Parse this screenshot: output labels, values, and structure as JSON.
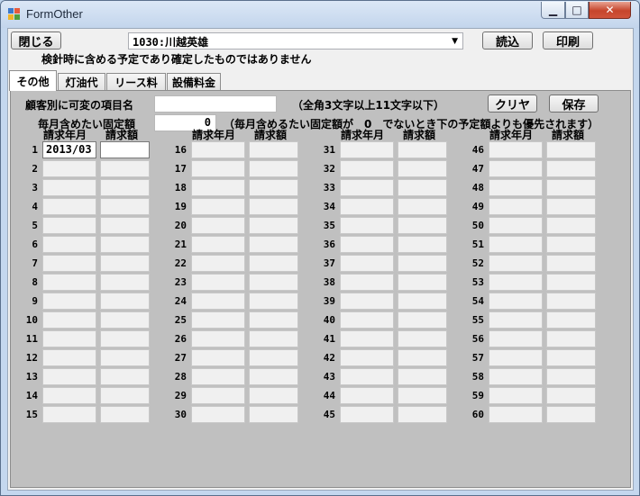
{
  "window": {
    "title": "FormOther",
    "min_glyph": "▁",
    "max_glyph": "□",
    "close_glyph": "✕",
    "icon_colors": [
      "#3c78c8",
      "#e65a3c",
      "#f0b428",
      "#50a03c"
    ]
  },
  "toolbar": {
    "close_label": "閉じる",
    "customer_select_value": "1030:川越英雄",
    "combo_arrow": "▼",
    "load_label": "読込",
    "print_label": "印刷"
  },
  "notice": "検針時に含める予定であり確定したものではありません",
  "tabs": [
    {
      "label": "その他",
      "active": true
    },
    {
      "label": "灯油代",
      "active": false
    },
    {
      "label": "リース料",
      "active": false
    },
    {
      "label": "設備料金",
      "active": false
    }
  ],
  "form": {
    "item_name_label": "顧客別に可変の項目名",
    "item_name_value": "",
    "item_name_hint": "（全角3文字以上11文字以下）",
    "clear_label": "クリヤ",
    "save_label": "保存",
    "fixed_amount_label": "毎月含めたい固定額",
    "fixed_amount_value": "0",
    "fixed_amount_hint": "（毎月含めるたい固定額が　0　でないとき下の予定額よりも優先されます）"
  },
  "grid": {
    "header_month": "請求年月",
    "header_amount": "請求額",
    "rows": [
      {
        "no": "1",
        "month": "2013/03",
        "amount": ""
      },
      {
        "no": "2",
        "month": "",
        "amount": ""
      },
      {
        "no": "3",
        "month": "",
        "amount": ""
      },
      {
        "no": "4",
        "month": "",
        "amount": ""
      },
      {
        "no": "5",
        "month": "",
        "amount": ""
      },
      {
        "no": "6",
        "month": "",
        "amount": ""
      },
      {
        "no": "7",
        "month": "",
        "amount": ""
      },
      {
        "no": "8",
        "month": "",
        "amount": ""
      },
      {
        "no": "9",
        "month": "",
        "amount": ""
      },
      {
        "no": "10",
        "month": "",
        "amount": ""
      },
      {
        "no": "11",
        "month": "",
        "amount": ""
      },
      {
        "no": "12",
        "month": "",
        "amount": ""
      },
      {
        "no": "13",
        "month": "",
        "amount": ""
      },
      {
        "no": "14",
        "month": "",
        "amount": ""
      },
      {
        "no": "15",
        "month": "",
        "amount": ""
      },
      {
        "no": "16",
        "month": "",
        "amount": ""
      },
      {
        "no": "17",
        "month": "",
        "amount": ""
      },
      {
        "no": "18",
        "month": "",
        "amount": ""
      },
      {
        "no": "19",
        "month": "",
        "amount": ""
      },
      {
        "no": "20",
        "month": "",
        "amount": ""
      },
      {
        "no": "21",
        "month": "",
        "amount": ""
      },
      {
        "no": "22",
        "month": "",
        "amount": ""
      },
      {
        "no": "23",
        "month": "",
        "amount": ""
      },
      {
        "no": "24",
        "month": "",
        "amount": ""
      },
      {
        "no": "25",
        "month": "",
        "amount": ""
      },
      {
        "no": "26",
        "month": "",
        "amount": ""
      },
      {
        "no": "27",
        "month": "",
        "amount": ""
      },
      {
        "no": "28",
        "month": "",
        "amount": ""
      },
      {
        "no": "29",
        "month": "",
        "amount": ""
      },
      {
        "no": "30",
        "month": "",
        "amount": ""
      },
      {
        "no": "31",
        "month": "",
        "amount": ""
      },
      {
        "no": "32",
        "month": "",
        "amount": ""
      },
      {
        "no": "33",
        "month": "",
        "amount": ""
      },
      {
        "no": "34",
        "month": "",
        "amount": ""
      },
      {
        "no": "35",
        "month": "",
        "amount": ""
      },
      {
        "no": "36",
        "month": "",
        "amount": ""
      },
      {
        "no": "37",
        "month": "",
        "amount": ""
      },
      {
        "no": "38",
        "month": "",
        "amount": ""
      },
      {
        "no": "39",
        "month": "",
        "amount": ""
      },
      {
        "no": "40",
        "month": "",
        "amount": ""
      },
      {
        "no": "41",
        "month": "",
        "amount": ""
      },
      {
        "no": "42",
        "month": "",
        "amount": ""
      },
      {
        "no": "43",
        "month": "",
        "amount": ""
      },
      {
        "no": "44",
        "month": "",
        "amount": ""
      },
      {
        "no": "45",
        "month": "",
        "amount": ""
      },
      {
        "no": "46",
        "month": "",
        "amount": ""
      },
      {
        "no": "47",
        "month": "",
        "amount": ""
      },
      {
        "no": "48",
        "month": "",
        "amount": ""
      },
      {
        "no": "49",
        "month": "",
        "amount": ""
      },
      {
        "no": "50",
        "month": "",
        "amount": ""
      },
      {
        "no": "51",
        "month": "",
        "amount": ""
      },
      {
        "no": "52",
        "month": "",
        "amount": ""
      },
      {
        "no": "53",
        "month": "",
        "amount": ""
      },
      {
        "no": "54",
        "month": "",
        "amount": ""
      },
      {
        "no": "55",
        "month": "",
        "amount": ""
      },
      {
        "no": "56",
        "month": "",
        "amount": ""
      },
      {
        "no": "57",
        "month": "",
        "amount": ""
      },
      {
        "no": "58",
        "month": "",
        "amount": ""
      },
      {
        "no": "59",
        "month": "",
        "amount": ""
      },
      {
        "no": "60",
        "month": "",
        "amount": ""
      }
    ]
  }
}
